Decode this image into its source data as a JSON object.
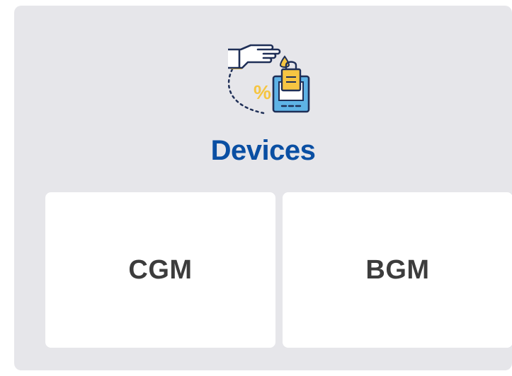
{
  "section": {
    "title": "Devices",
    "icon": "device-finger-drop-icon"
  },
  "cards": [
    {
      "label": "CGM"
    },
    {
      "label": "BGM"
    }
  ],
  "colors": {
    "panel_bg": "#e6e6ea",
    "title": "#0a4fa3",
    "card_bg": "#ffffff",
    "card_text": "#3c3c3c",
    "icon_blue": "#5eb3e6",
    "icon_yellow": "#f5c542",
    "icon_navy": "#1f2f57"
  }
}
